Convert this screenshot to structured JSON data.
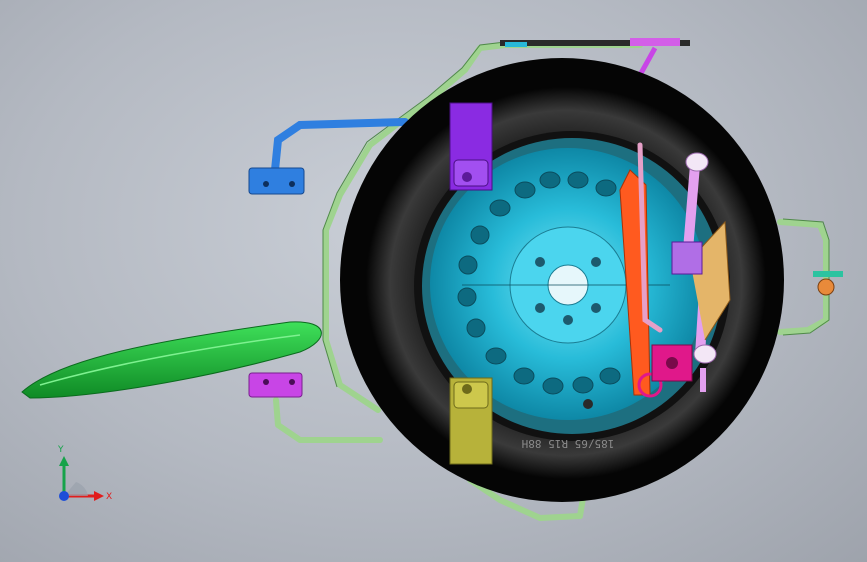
{
  "viewport": {
    "background": "#b9bec6"
  },
  "tire": {
    "sidewall_text": "185/65 R15 88H",
    "color": "#0b0b0b"
  },
  "wheel": {
    "color": "#2cc3df"
  },
  "parts": [
    {
      "name": "spare-tire",
      "color": "#0b0b0b"
    },
    {
      "name": "steel-wheel",
      "color": "#2cc3df"
    },
    {
      "name": "tubular-frame",
      "color": "#9fd38f"
    },
    {
      "name": "jack-handle",
      "color": "#ff5a1f"
    },
    {
      "name": "scissor-jack",
      "color": "#e3a0ef"
    },
    {
      "name": "purple-bracket",
      "color": "#8a2be2"
    },
    {
      "name": "olive-bracket",
      "color": "#b7b23a"
    },
    {
      "name": "blue-mount",
      "color": "#2f7fe0"
    },
    {
      "name": "magenta-mount",
      "color": "#c845e6"
    },
    {
      "name": "green-lever",
      "color": "#1fb83a"
    },
    {
      "name": "tow-hook",
      "color": "#e0188a"
    }
  ],
  "triad": {
    "x_label": "X",
    "y_label": "Y",
    "x_color": "#e11d1d",
    "y_color": "#16a34a",
    "z_color": "#1d4ed8"
  }
}
